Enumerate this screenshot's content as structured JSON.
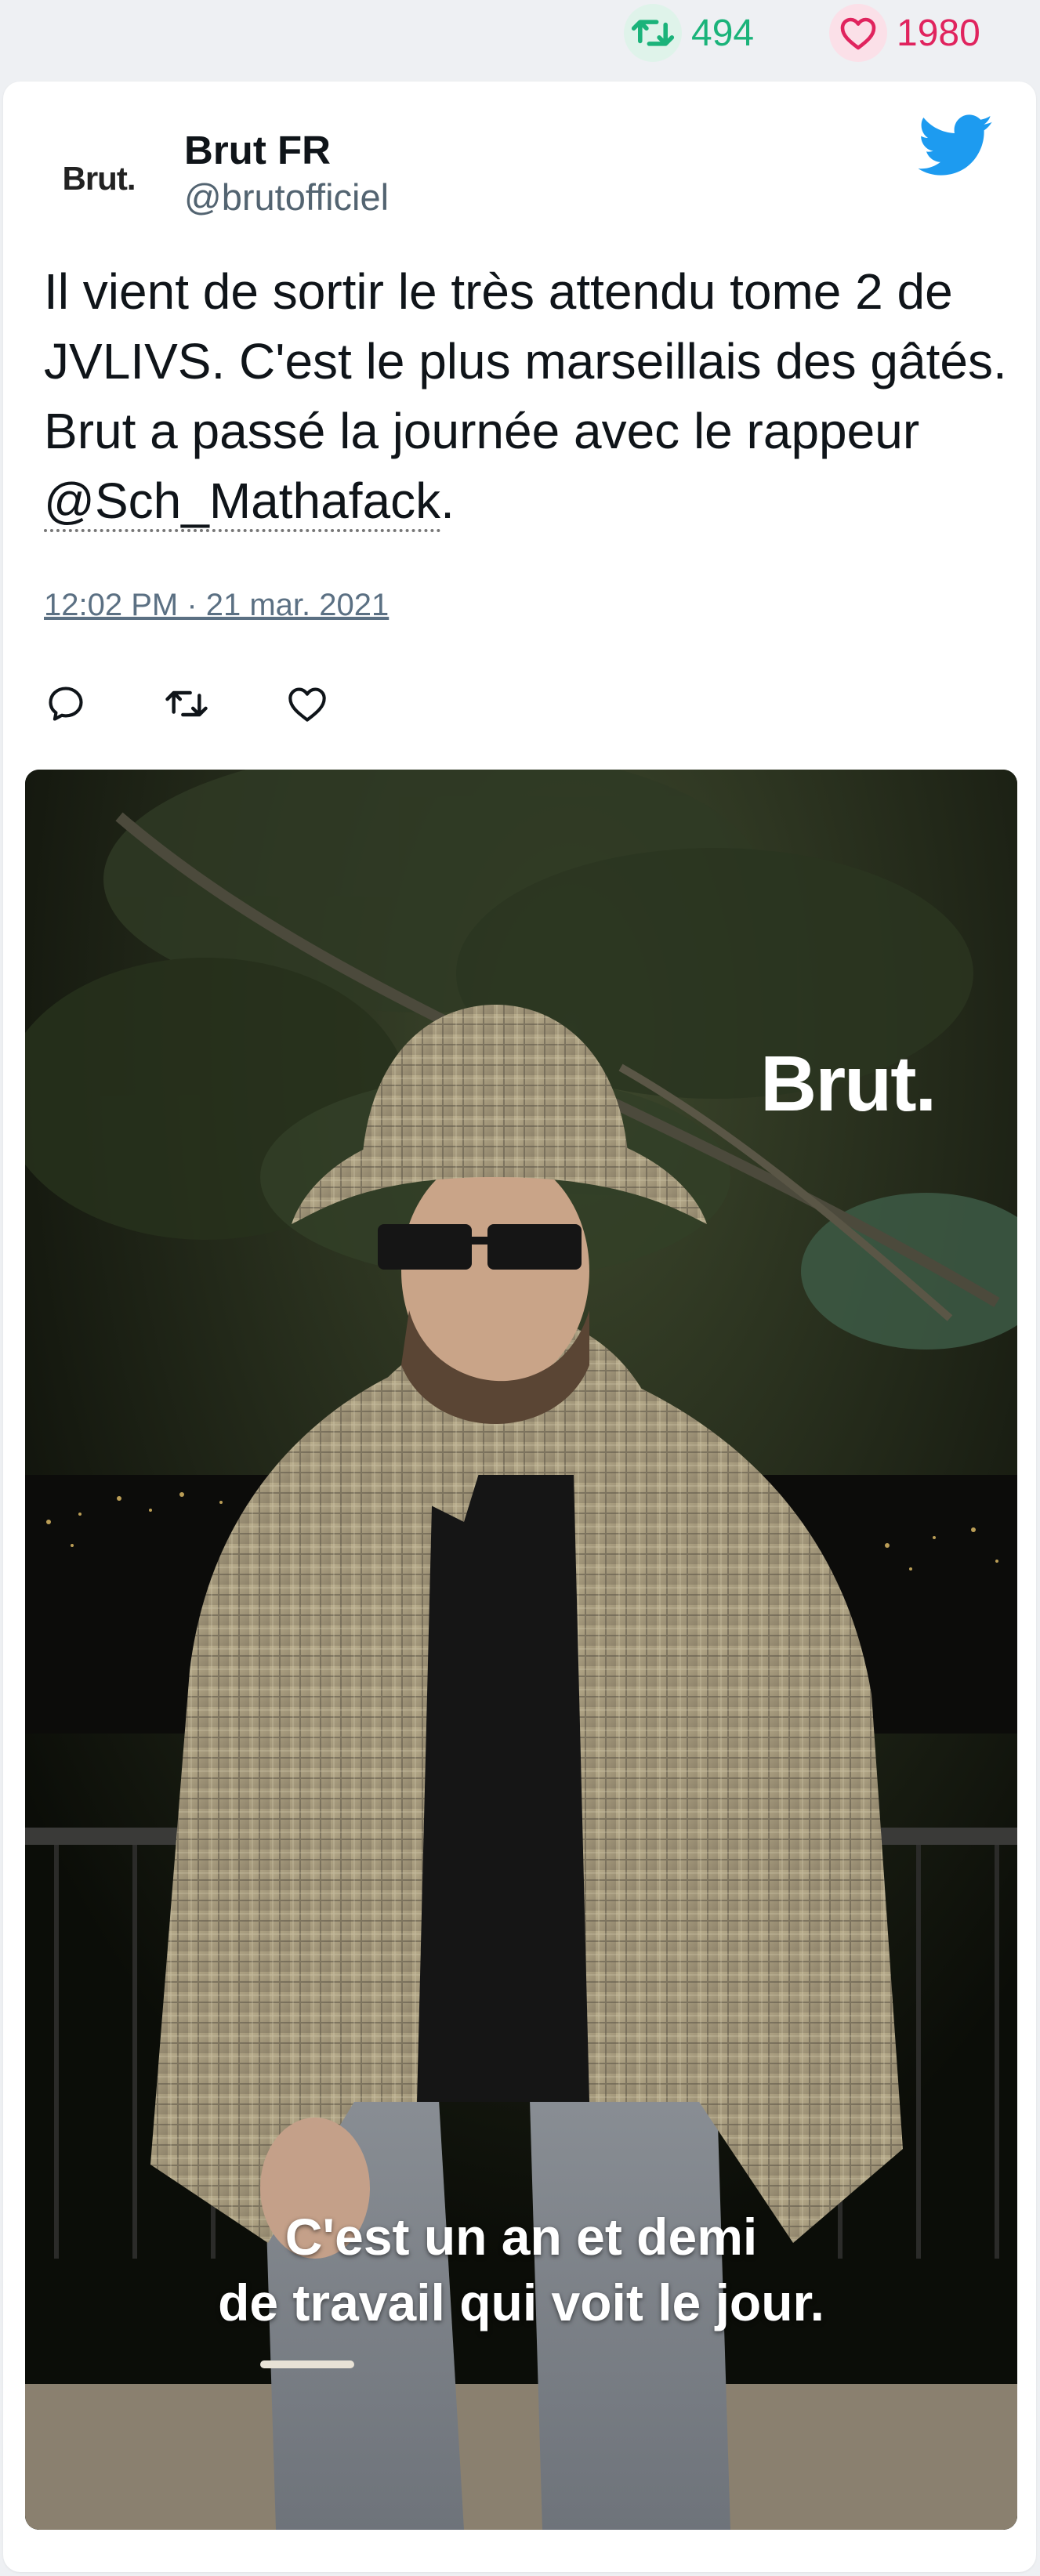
{
  "stats": {
    "retweets": "494",
    "likes": "1980",
    "retweet_color": "#1bb37a",
    "like_color": "#e0245e",
    "retweet_icon": "retweet-icon",
    "like_icon": "heart-icon"
  },
  "tweet": {
    "avatar_text": "Brut.",
    "display_name": "Brut FR",
    "handle": "@brutofficiel",
    "logo_icon": "twitter-bird-icon",
    "text_before_mention": "Il vient de sortir le très attendu tome 2 de JVLIVS. C'est le plus marseillais des gâtés. Brut a passé la journée avec le rappeur ",
    "mention": "@Sch_Mathafack",
    "text_after_mention": ".",
    "timestamp": "12:02 PM · 21 mar. 2021",
    "actions": [
      "reply-icon",
      "retweet-icon",
      "like-icon"
    ]
  },
  "media": {
    "brand": "Brut.",
    "caption_line_1": "C'est un an et demi",
    "caption_line_2": "de travail qui voit le jour."
  }
}
